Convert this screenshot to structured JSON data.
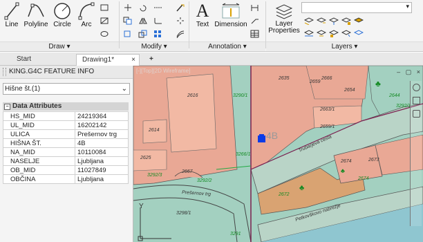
{
  "ribbon": {
    "draw": {
      "line": "Line",
      "polyline": "Polyline",
      "circle": "Circle",
      "arc": "Arc",
      "panel": "Draw"
    },
    "modify": {
      "panel": "Modify"
    },
    "annotation": {
      "text": "Text",
      "dimension": "Dimension",
      "panel": "Annotation"
    },
    "layers": {
      "layer_properties_line1": "Layer",
      "layer_properties_line2": "Properties",
      "panel": "Layers",
      "layer_dropdown_value": ""
    }
  },
  "tabs": {
    "start": "Start",
    "drawing": "Drawing1*",
    "add": "+"
  },
  "left_panel": {
    "title": "KING.G4C FEATURE INFO",
    "select_value": "Hišne št.(1)",
    "section": "Data Attributes",
    "attributes": [
      {
        "key": "HS_MID",
        "value": "24219364"
      },
      {
        "key": "UL_MID",
        "value": "16202142"
      },
      {
        "key": "ULICA",
        "value": "Prešernov trg"
      },
      {
        "key": "HIŠNA ŠT.",
        "value": "4B"
      },
      {
        "key": "NA_MID",
        "value": "10110084"
      },
      {
        "key": "NASELJE",
        "value": "Ljubljana"
      },
      {
        "key": "OB_MID",
        "value": "11027849"
      },
      {
        "key": "OBČINA",
        "value": "Ljubljana"
      }
    ]
  },
  "map": {
    "view_label": "[-][Top][2D Wireframe]",
    "address_label": "4B",
    "streets": [
      "Trubarjeva cesta",
      "Prešernov trg",
      "Petkovškovo nabrežje"
    ],
    "parcels": [
      "2666",
      "2635",
      "2616",
      "2644",
      "2654",
      "2614",
      "2663/1",
      "2659/1",
      "2667",
      "2674",
      "2672",
      "2673",
      "2625",
      "2674",
      "3290/1",
      "3292/3",
      "3292/2",
      "3298/1",
      "2659",
      "3266/1",
      "3291",
      "3292/1"
    ],
    "axis_label": "Y",
    "colors": {
      "water": "#a3d0c0",
      "parcel": "#e9a895",
      "building": "#f2b9a4",
      "orange": "#d9a372",
      "selected": "#0b3be6",
      "street": "#b9d4c7"
    }
  }
}
